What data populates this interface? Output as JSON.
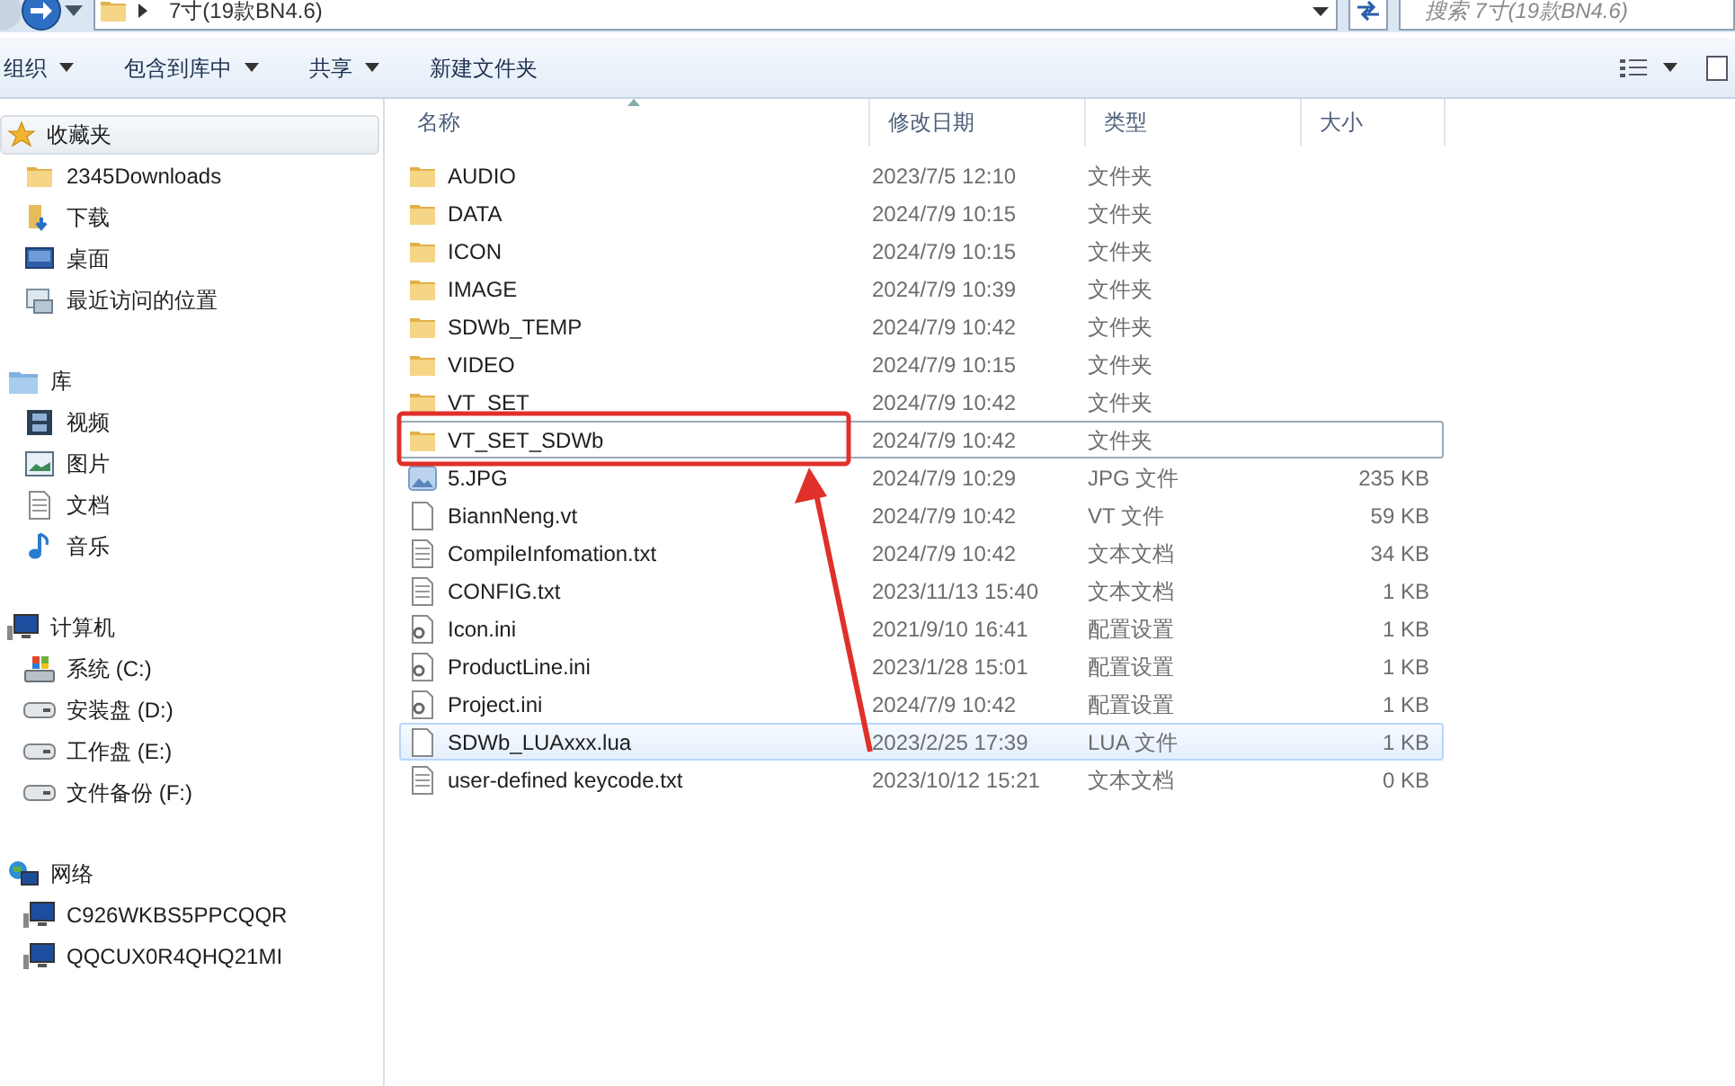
{
  "address_bar": {
    "path": "7寸(19款BN4.6)",
    "search_placeholder": "搜索 7寸(19款BN4.6)"
  },
  "toolbar": {
    "items": [
      {
        "label": "组织",
        "dropdown": true
      },
      {
        "label": "包含到库中",
        "dropdown": true
      },
      {
        "label": "共享",
        "dropdown": true
      },
      {
        "label": "新建文件夹",
        "dropdown": false
      }
    ]
  },
  "sidebar": {
    "groups": [
      {
        "label": "收藏夹",
        "kind": "favorites",
        "selected": true,
        "children": [
          {
            "label": "2345Downloads",
            "kind": "folder"
          },
          {
            "label": "下载",
            "kind": "download"
          },
          {
            "label": "桌面",
            "kind": "desktop"
          },
          {
            "label": "最近访问的位置",
            "kind": "recent"
          }
        ]
      },
      {
        "label": "库",
        "kind": "library",
        "selected": false,
        "children": [
          {
            "label": "视频",
            "kind": "video"
          },
          {
            "label": "图片",
            "kind": "picture"
          },
          {
            "label": "文档",
            "kind": "document"
          },
          {
            "label": "音乐",
            "kind": "music"
          }
        ]
      },
      {
        "label": "计算机",
        "kind": "computer",
        "selected": false,
        "children": [
          {
            "label": "系统 (C:)",
            "kind": "system-drive"
          },
          {
            "label": "安装盘 (D:)",
            "kind": "drive"
          },
          {
            "label": "工作盘 (E:)",
            "kind": "drive"
          },
          {
            "label": "文件备份 (F:)",
            "kind": "drive"
          }
        ]
      },
      {
        "label": "网络",
        "kind": "network",
        "selected": false,
        "children": [
          {
            "label": "C926WKBS5PPCQQR",
            "kind": "computer"
          },
          {
            "label": "QQCUX0R4QHQ21MI",
            "kind": "computer"
          }
        ]
      }
    ]
  },
  "table": {
    "columns": [
      "名称",
      "修改日期",
      "类型",
      "大小"
    ],
    "rows": [
      {
        "name": "AUDIO",
        "date": "2023/7/5 12:10",
        "type": "文件夹",
        "kind": "folder",
        "selected": false,
        "hovered": false
      },
      {
        "name": "DATA",
        "date": "2024/7/9 10:15",
        "type": "文件夹",
        "kind": "folder",
        "selected": false,
        "hovered": false
      },
      {
        "name": "ICON",
        "date": "2024/7/9 10:15",
        "type": "文件夹",
        "kind": "folder",
        "selected": false,
        "hovered": false
      },
      {
        "name": "IMAGE",
        "date": "2024/7/9 10:39",
        "type": "文件夹",
        "kind": "folder",
        "selected": false,
        "hovered": false
      },
      {
        "name": "SDWb_TEMP",
        "date": "2024/7/9 10:42",
        "type": "文件夹",
        "kind": "folder",
        "selected": false,
        "hovered": false
      },
      {
        "name": "VIDEO",
        "date": "2024/7/9 10:15",
        "type": "文件夹",
        "kind": "folder",
        "selected": false,
        "hovered": false
      },
      {
        "name": "VT_SET",
        "date": "2024/7/9 10:42",
        "type": "文件夹",
        "kind": "folder",
        "selected": false,
        "hovered": false
      },
      {
        "name": "VT_SET_SDWb",
        "date": "2024/7/9 10:42",
        "type": "文件夹",
        "kind": "folder",
        "selected": true,
        "hovered": false
      },
      {
        "name": "5.JPG",
        "date": "2024/7/9 10:29",
        "type": "JPG 文件",
        "size": "235 KB",
        "kind": "image",
        "selected": false,
        "hovered": false
      },
      {
        "name": "BiannNeng.vt",
        "date": "2024/7/9 10:42",
        "type": "VT 文件",
        "size": "59 KB",
        "kind": "file",
        "selected": false,
        "hovered": false
      },
      {
        "name": "CompileInfomation.txt",
        "date": "2024/7/9 10:42",
        "type": "文本文档",
        "size": "34 KB",
        "kind": "text",
        "selected": false,
        "hovered": false
      },
      {
        "name": "CONFIG.txt",
        "date": "2023/11/13 15:40",
        "type": "文本文档",
        "size": "1 KB",
        "kind": "text",
        "selected": false,
        "hovered": false
      },
      {
        "name": "Icon.ini",
        "date": "2021/9/10 16:41",
        "type": "配置设置",
        "size": "1 KB",
        "kind": "config",
        "selected": false,
        "hovered": false
      },
      {
        "name": "ProductLine.ini",
        "date": "2023/1/28 15:01",
        "type": "配置设置",
        "size": "1 KB",
        "kind": "config",
        "selected": false,
        "hovered": false
      },
      {
        "name": "Project.ini",
        "date": "2024/7/9 10:42",
        "type": "配置设置",
        "size": "1 KB",
        "kind": "config",
        "selected": false,
        "hovered": false
      },
      {
        "name": "SDWb_LUAxxx.lua",
        "date": "2023/2/25 17:39",
        "type": "LUA 文件",
        "size": "1 KB",
        "kind": "file",
        "selected": false,
        "hovered": true
      },
      {
        "name": "user-defined keycode.txt",
        "date": "2023/10/12 15:21",
        "type": "文本文档",
        "size": "0 KB",
        "kind": "text",
        "selected": false,
        "hovered": false
      }
    ]
  }
}
